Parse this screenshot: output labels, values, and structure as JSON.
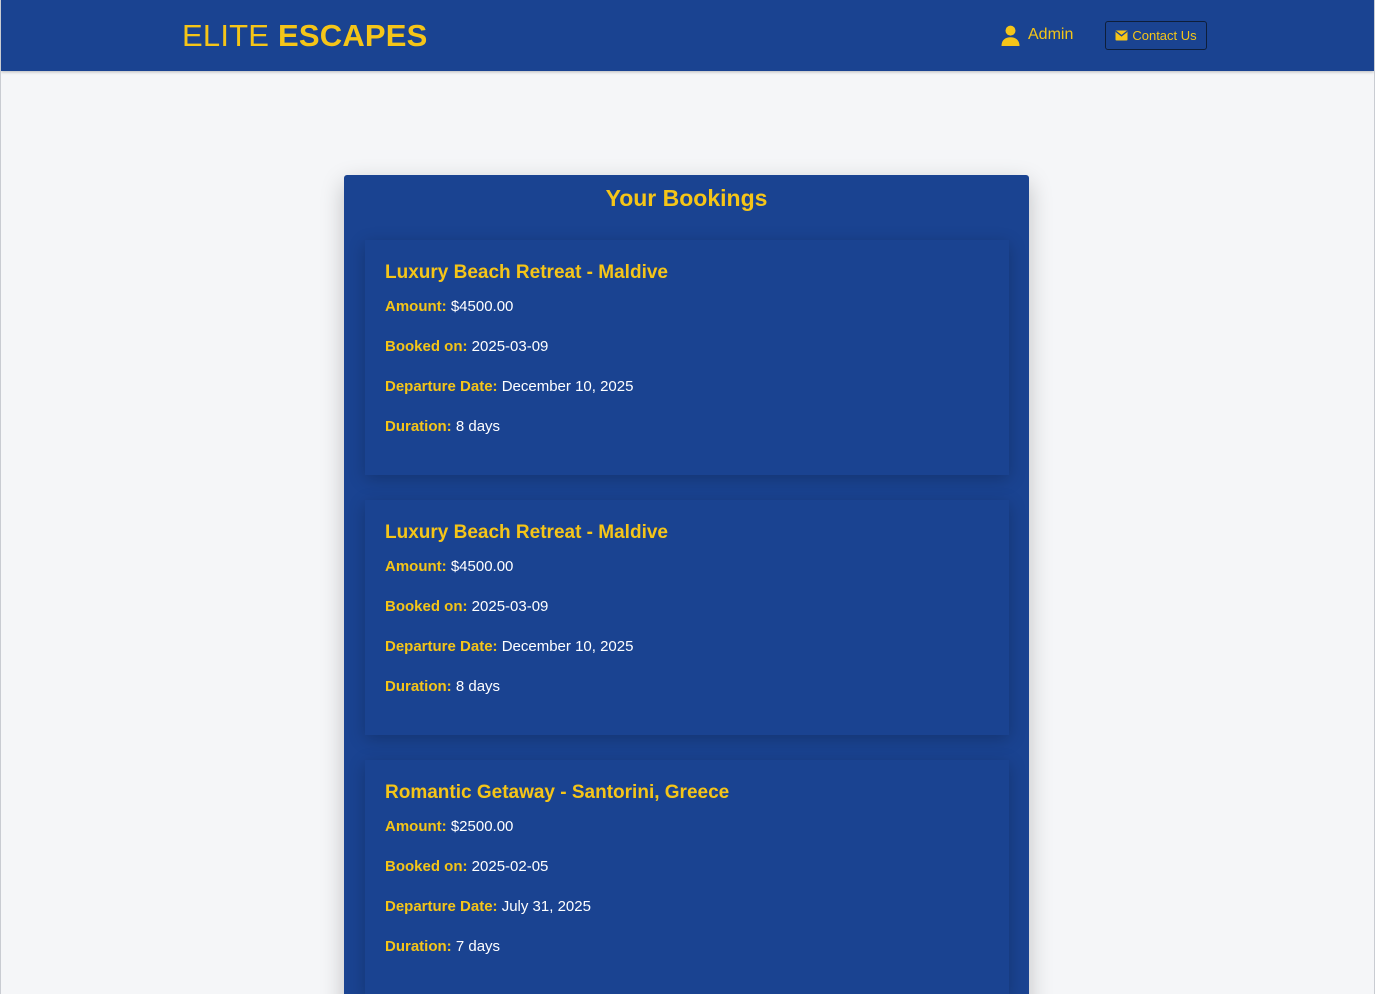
{
  "header": {
    "brand_light": "ELITE",
    "brand_bold": "ESCAPES",
    "admin_label": "Admin",
    "contact_label": "Contact Us"
  },
  "page": {
    "title": "Your Bookings"
  },
  "labels": {
    "amount": "Amount:",
    "booked_on": "Booked on:",
    "departure": "Departure Date:",
    "duration": "Duration:"
  },
  "bookings": [
    {
      "title": "Luxury Beach Retreat - Maldive",
      "amount": "$4500.00",
      "booked_on": "2025-03-09",
      "departure": "December 10, 2025",
      "duration": "8 days"
    },
    {
      "title": "Luxury Beach Retreat - Maldive",
      "amount": "$4500.00",
      "booked_on": "2025-03-09",
      "departure": "December 10, 2025",
      "duration": "8 days"
    },
    {
      "title": "Romantic Getaway - Santorini, Greece",
      "amount": "$2500.00",
      "booked_on": "2025-02-05",
      "departure": "July 31, 2025",
      "duration": "7 days"
    }
  ],
  "colors": {
    "primary": "#1a4391",
    "accent": "#f5c518",
    "background": "#f5f6f8",
    "text": "#ffffff"
  },
  "icons": {
    "admin": "user-icon",
    "contact": "envelope-icon"
  }
}
